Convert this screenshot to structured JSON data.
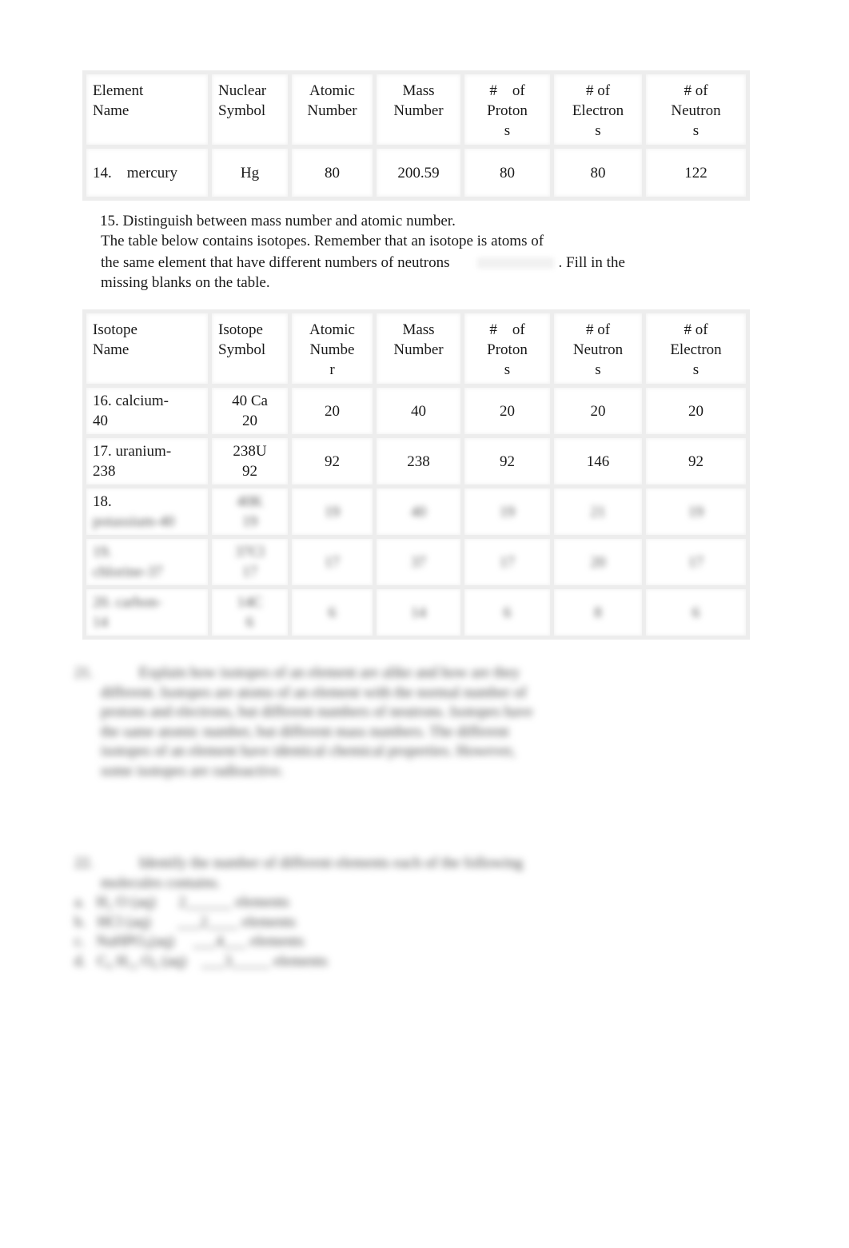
{
  "table1": {
    "headers": [
      "Element\nName",
      "Nuclear\nSymbol",
      "Atomic\nNumber",
      "Mass\nNumber",
      "#    of\nProton\ns",
      "# of\nElectron\ns",
      "# of\nNeutron\ns"
    ],
    "rows": [
      [
        "14.    mercury",
        "Hg",
        "80",
        "200.59",
        "80",
        "80",
        "122"
      ]
    ]
  },
  "question15": {
    "line1": "15. Distinguish between mass number and atomic number.",
    "line2": "The table below contains isotopes. Remember that an isotope is atoms of",
    "line3a": "the same element that have different numbers of neutrons",
    "line3b": ". Fill in the",
    "line4": "missing blanks on the table."
  },
  "table2": {
    "headers": [
      "Isotope\nName",
      "Isotope\nSymbol",
      "Atomic\nNumbe\nr",
      "Mass\nNumber",
      "#    of\nProton\ns",
      "# of\nNeutron\ns",
      "# of\nElectron\ns"
    ],
    "rows": [
      [
        "16. calcium-\n40",
        " 40 Ca\n20",
        "20",
        "40",
        "20",
        "20",
        "20"
      ],
      [
        "17.    uranium-\n238",
        "238U\n92",
        "92",
        "238",
        "92",
        "146",
        "92"
      ],
      [
        "18.\npotassium-40",
        "40K\n19",
        "19",
        "40",
        "19",
        "21",
        "19"
      ],
      [
        "19.\nchlorine-37",
        "37Cl\n17",
        "17",
        "37",
        "17",
        "20",
        "17"
      ],
      [
        "20.    carbon-\n14",
        "14C\n6",
        "6",
        "14",
        "6",
        "8",
        "6"
      ]
    ],
    "blurred_rows_from_index": 2
  },
  "question21": {
    "lines": [
      "21.            Explain how isotopes of an element are alike and how are they",
      "different. Isotopes are atoms of an element with the normal number of",
      "protons and electrons, but different numbers of neutrons. Isotopes have",
      "the same atomic number, but different mass numbers. The different",
      "isotopes of an element have identical chemical properties. However,",
      "some isotopes are radioactive."
    ]
  },
  "question22": {
    "lines": [
      "22.            Identify the number of different elements each of the following",
      "molecules contains.",
      "a.   H₂ O (aq)      2______ elements",
      "b.   HCl (aq)       ___2____ elements",
      "c.   NaHPO₄(aq)     ___4___ elements",
      "d.   C₆ H₁₂ O₆ (aq)    ___3_____ elements"
    ]
  }
}
